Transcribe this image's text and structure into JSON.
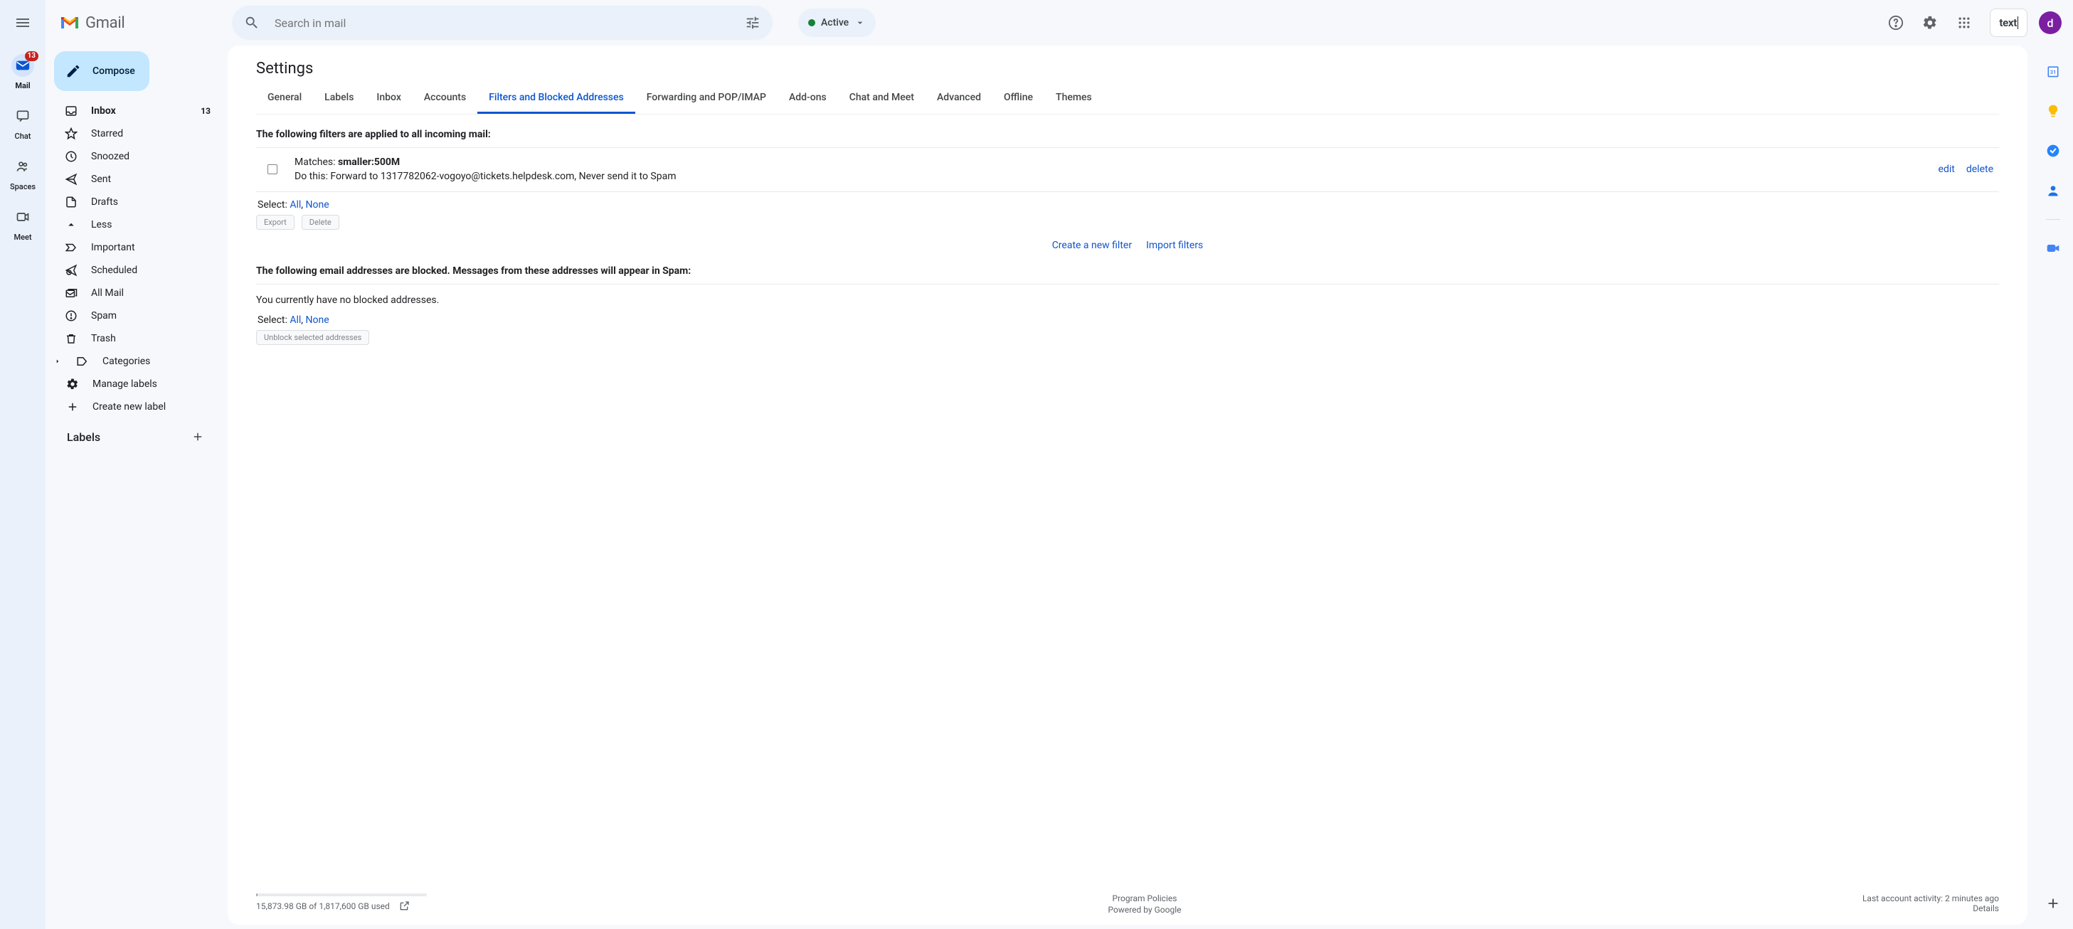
{
  "brand": {
    "name": "Gmail"
  },
  "navRail": {
    "items": [
      {
        "label": "Mail",
        "badge": "13",
        "active": true
      },
      {
        "label": "Chat"
      },
      {
        "label": "Spaces"
      },
      {
        "label": "Meet"
      }
    ]
  },
  "search": {
    "placeholder": "Search in mail"
  },
  "status": {
    "label": "Active"
  },
  "textInput": {
    "value": "text"
  },
  "avatar": {
    "initial": "d"
  },
  "compose": {
    "label": "Compose"
  },
  "sidebar": {
    "items": [
      {
        "label": "Inbox",
        "count": "13",
        "bold": true
      },
      {
        "label": "Starred"
      },
      {
        "label": "Snoozed"
      },
      {
        "label": "Sent"
      },
      {
        "label": "Drafts"
      },
      {
        "label": "Less"
      },
      {
        "label": "Important"
      },
      {
        "label": "Scheduled"
      },
      {
        "label": "All Mail"
      },
      {
        "label": "Spam"
      },
      {
        "label": "Trash"
      },
      {
        "label": "Categories"
      },
      {
        "label": "Manage labels"
      },
      {
        "label": "Create new label"
      }
    ],
    "labelsHeader": "Labels"
  },
  "settings": {
    "title": "Settings",
    "tabs": [
      "General",
      "Labels",
      "Inbox",
      "Accounts",
      "Filters and Blocked Addresses",
      "Forwarding and POP/IMAP",
      "Add-ons",
      "Chat and Meet",
      "Advanced",
      "Offline",
      "Themes"
    ],
    "activeTab": 4,
    "filtersIntro": "The following filters are applied to all incoming mail:",
    "filter": {
      "matchesLabel": "Matches: ",
      "matchesValue": "smaller:500M",
      "doThis": "Do this: Forward to 1317782062-vogoyo@tickets.helpdesk.com, Never send it to Spam",
      "edit": "edit",
      "delete": "delete"
    },
    "selectLabel": "Select: ",
    "selectAll": "All",
    "selectNone": "None",
    "exportBtn": "Export",
    "deleteBtn": "Delete",
    "createFilter": "Create a new filter",
    "importFilters": "Import filters",
    "blockedIntro": "The following email addresses are blocked. Messages from these addresses will appear in Spam:",
    "noBlocked": "You currently have no blocked addresses.",
    "unblockBtn": "Unblock selected addresses"
  },
  "footer": {
    "storage": "15,873.98 GB of 1,817,600 GB used",
    "policies": "Program Policies",
    "powered": "Powered by Google",
    "activity": "Last account activity: 2 minutes ago",
    "details": "Details"
  }
}
